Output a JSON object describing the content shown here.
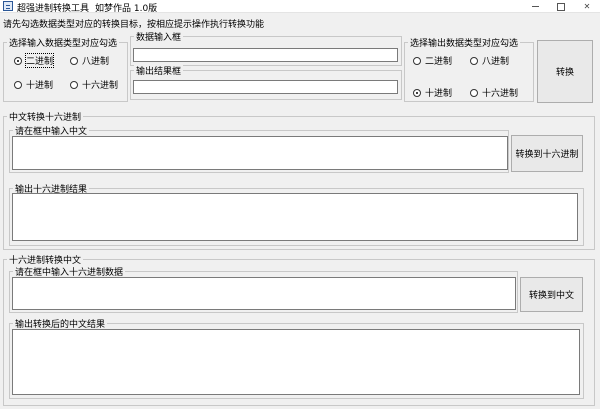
{
  "window": {
    "title": "超强进制转换工具",
    "author": "如梦作品 1.0版"
  },
  "hint": "请先勾选数据类型对应的转换目标，按相应提示操作执行转换功能",
  "input_type_group": {
    "legend": "选择输入数据类型对应勾选",
    "options": [
      {
        "label": "二进制",
        "selected": true
      },
      {
        "label": "八进制",
        "selected": false
      },
      {
        "label": "十进制",
        "selected": false
      },
      {
        "label": "十六进制",
        "selected": false
      }
    ]
  },
  "data_input": {
    "legend": "数据输入框",
    "value": ""
  },
  "output_result": {
    "legend": "输出结果框",
    "value": ""
  },
  "output_type_group": {
    "legend": "选择输出数据类型对应勾选",
    "options": [
      {
        "label": "二进制",
        "selected": false
      },
      {
        "label": "八进制",
        "selected": false
      },
      {
        "label": "十进制",
        "selected": true
      },
      {
        "label": "十六进制",
        "selected": false
      }
    ]
  },
  "convert_button": "转换",
  "cn_to_hex": {
    "legend": "中文转换十六进制",
    "input_label": "请在框中输入中文",
    "input_value": "",
    "button": "转换到十六进制",
    "output_label": "输出十六进制结果",
    "output_value": ""
  },
  "hex_to_cn": {
    "legend": "十六进制转换中文",
    "input_label": "请在框中输入十六进制数据",
    "input_value": "",
    "button": "转换到中文",
    "output_label": "输出转换后的中文结果",
    "output_value": ""
  }
}
